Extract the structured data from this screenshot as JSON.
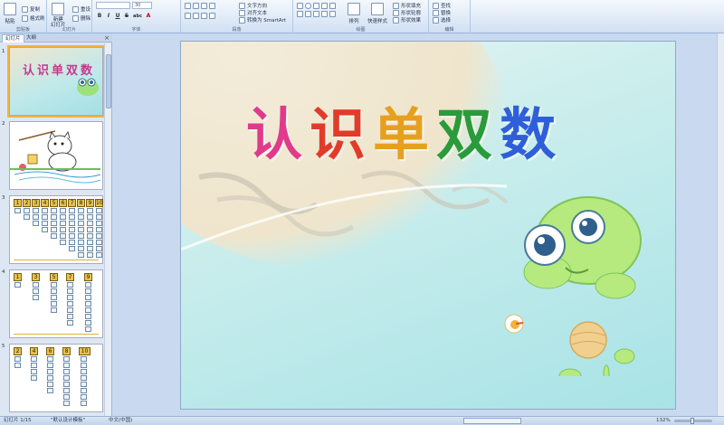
{
  "ribbon": {
    "clipboard": {
      "label": "剪贴板",
      "paste": "粘贴",
      "copy": "复制",
      "format_painter": "格式刷"
    },
    "slides": {
      "label": "幻灯片",
      "new_slide": "新建\n幻灯片",
      "reset": "重设",
      "delete": "删除"
    },
    "font": {
      "label": "字体",
      "size": "30",
      "buttons": [
        "B",
        "I",
        "U",
        "S",
        "abc",
        "A"
      ]
    },
    "paragraph": {
      "label": "段落",
      "text_direction": "文字方向",
      "align_text": "对齐文本",
      "smartart": "转换为 SmartArt"
    },
    "drawing": {
      "label": "绘图",
      "arrange": "排列",
      "quick_styles": "快速样式",
      "shape_fill": "形状填充",
      "shape_outline": "形状轮廓",
      "shape_effects": "形状效果"
    },
    "editing": {
      "label": "编辑",
      "find": "查找",
      "replace": "替换",
      "select": "选择"
    }
  },
  "panel": {
    "tab_slides": "幻灯片",
    "tab_outline": "大纲",
    "close": "×",
    "thumbnails": [
      {
        "num": "1",
        "title": "认识单双数"
      },
      {
        "num": "2"
      },
      {
        "num": "3",
        "cells": [
          "1",
          "2",
          "3",
          "4",
          "5",
          "6",
          "7",
          "8",
          "9",
          "10"
        ]
      },
      {
        "num": "4",
        "cells": [
          "1",
          "3",
          "5",
          "7",
          "9"
        ]
      },
      {
        "num": "5",
        "cells": [
          "2",
          "4",
          "6",
          "8",
          "10"
        ]
      }
    ]
  },
  "slide": {
    "title_chars": [
      "认",
      "识",
      "单",
      "双",
      "数"
    ],
    "title_colors": [
      "#e03a8c",
      "#e33b2a",
      "#e6a020",
      "#2a9b3a",
      "#2f5fd8"
    ]
  },
  "status": {
    "slide_info": "幻灯片 1/15",
    "theme": "\"默认设计模板\"",
    "language": "中文(中国)",
    "zoom": "132%"
  }
}
